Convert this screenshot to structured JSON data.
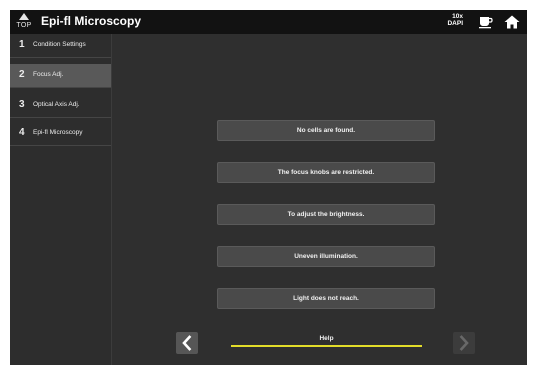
{
  "header": {
    "top_label": "TOP",
    "title": "Epi-fl Microscopy",
    "objective_mag": "10x",
    "objective_filter": "DAPI"
  },
  "icons": {
    "top": "triangle-up-icon",
    "cup": "coffee-cup-icon",
    "home": "home-icon"
  },
  "sidebar": {
    "items": [
      {
        "num": "1",
        "label": "Condition Settings",
        "active": false
      },
      {
        "num": "2",
        "label": "Focus Adj.",
        "active": true
      },
      {
        "num": "3",
        "label": "Optical Axis Adj.",
        "active": false
      },
      {
        "num": "4",
        "label": "Epi-fl Microscopy",
        "active": false
      }
    ]
  },
  "main": {
    "options": [
      "No cells are found.",
      "The focus knobs are restricted.",
      "To adjust the brightness.",
      "Uneven illumination.",
      "Light does not reach."
    ],
    "help_label": "Help"
  },
  "colors": {
    "background": "#2f2f2f",
    "header": "#121212",
    "active_sidebar": "#595959",
    "accent_line": "#e3dd2a"
  }
}
